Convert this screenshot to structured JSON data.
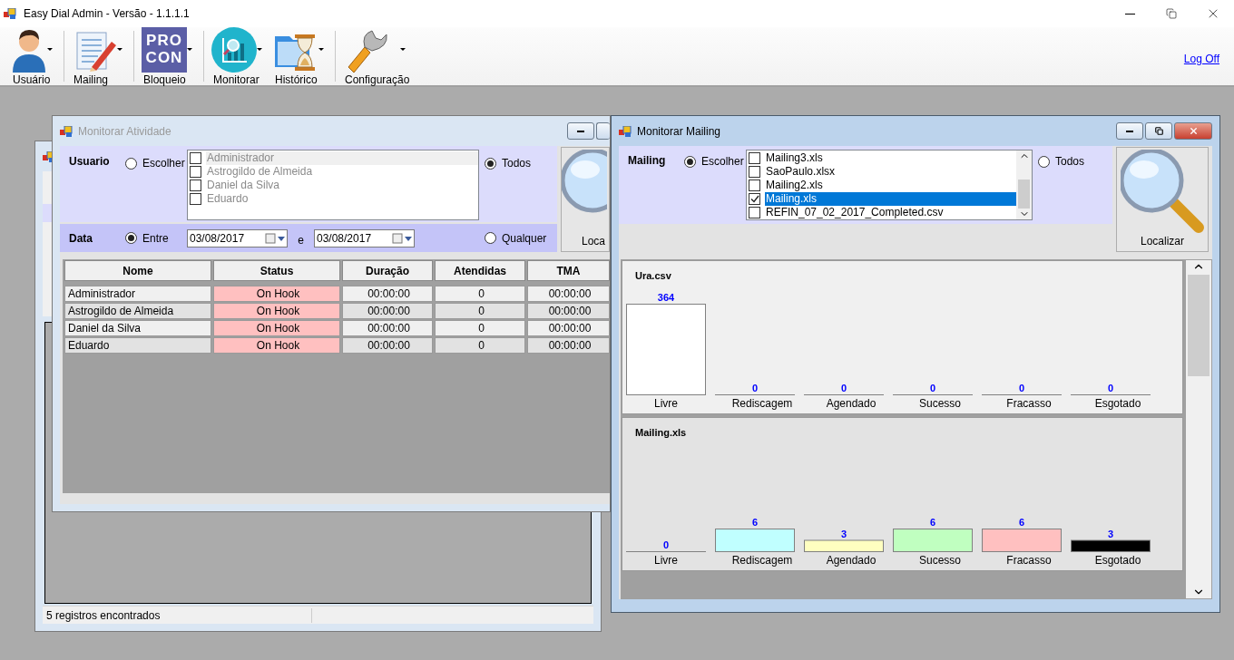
{
  "window": {
    "title": "Easy Dial Admin - Versão - 1.1.1.1"
  },
  "toolbar": {
    "groups": [
      [
        {
          "label": "Usuário",
          "kind": "user"
        }
      ],
      [
        {
          "label": "Mailing",
          "kind": "mailing"
        }
      ],
      [
        {
          "label": "Bloqueio",
          "kind": "procon",
          "icon_text": [
            "PRO",
            "CON"
          ]
        }
      ],
      [
        {
          "label": "Monitorar",
          "kind": "monitor"
        },
        {
          "label": "Histórico",
          "kind": "history"
        }
      ],
      [
        {
          "label": "Configuração",
          "kind": "config"
        }
      ]
    ],
    "logoff": "Log Off"
  },
  "background_window": {
    "status_text": "5 registros encontrados"
  },
  "activity_window": {
    "title": "Monitorar Atividade",
    "active": false,
    "user_filter": {
      "label": "Usuario",
      "options": [
        {
          "label": "Escolher",
          "selected": false
        },
        {
          "label": "Todos",
          "selected": true
        }
      ],
      "list": {
        "disabled": true,
        "items": [
          {
            "label": "Administrador",
            "checked": false,
            "selected": true
          },
          {
            "label": "Astrogildo de Almeida",
            "checked": false,
            "selected": false
          },
          {
            "label": "Daniel da Silva",
            "checked": false,
            "selected": false
          },
          {
            "label": "Eduardo",
            "checked": false,
            "selected": false
          }
        ]
      }
    },
    "date_filter": {
      "label": "Data",
      "options": [
        {
          "label": "Entre",
          "selected": true
        },
        {
          "label": "Qualquer",
          "selected": false
        }
      ],
      "from": "03/08/2017",
      "separator": "e",
      "to": "03/08/2017"
    },
    "search_button": "Loca",
    "table": {
      "columns": [
        "Nome",
        "Status",
        "Duração",
        "Atendidas",
        "TMA"
      ],
      "rows": [
        {
          "cells": [
            "Administrador",
            "On Hook",
            "00:00:00",
            "0",
            "00:00:00"
          ]
        },
        {
          "cells": [
            "Astrogildo de Almeida",
            "On Hook",
            "00:00:00",
            "0",
            "00:00:00"
          ]
        },
        {
          "cells": [
            "Daniel da Silva",
            "On Hook",
            "00:00:00",
            "0",
            "00:00:00"
          ]
        },
        {
          "cells": [
            "Eduardo",
            "On Hook",
            "00:00:00",
            "0",
            "00:00:00"
          ]
        }
      ]
    }
  },
  "mailing_window": {
    "title": "Monitorar Mailing",
    "active": true,
    "filter": {
      "label": "Mailing",
      "options": [
        {
          "label": "Escolher",
          "selected": true
        },
        {
          "label": "Todos",
          "selected": false
        }
      ],
      "list": {
        "disabled": false,
        "items": [
          {
            "label": "Mailing3.xls",
            "checked": false,
            "selected": false
          },
          {
            "label": "SaoPaulo.xlsx",
            "checked": false,
            "selected": false
          },
          {
            "label": "Mailing2.xls",
            "checked": false,
            "selected": false
          },
          {
            "label": "Mailing.xls",
            "checked": true,
            "selected": true
          },
          {
            "label": "REFIN_07_02_2017_Completed.csv",
            "checked": false,
            "selected": false
          }
        ]
      }
    },
    "search_button": "Localizar",
    "bar_styles": [
      {
        "color": "#ffffff"
      },
      {
        "color": "#c0ffff"
      },
      {
        "color": "#ffffc0"
      },
      {
        "color": "#c0ffc0"
      },
      {
        "color": "#ffc0c0"
      },
      {
        "color": "#000000"
      }
    ],
    "charts": [
      {
        "chart_data": {
          "type": "bar",
          "title": "Ura.csv",
          "categories": [
            "Livre",
            "Rediscagem",
            "Agendado",
            "Sucesso",
            "Fracasso",
            "Esgotado"
          ],
          "values": [
            364,
            0,
            0,
            0,
            0,
            0
          ],
          "data_labels": true
        }
      },
      {
        "chart_data": {
          "type": "bar",
          "title": "Mailing.xls",
          "categories": [
            "Livre",
            "Rediscagem",
            "Agendado",
            "Sucesso",
            "Fracasso",
            "Esgotado"
          ],
          "values": [
            0,
            6,
            3,
            6,
            6,
            3
          ],
          "data_labels": true
        }
      }
    ]
  }
}
